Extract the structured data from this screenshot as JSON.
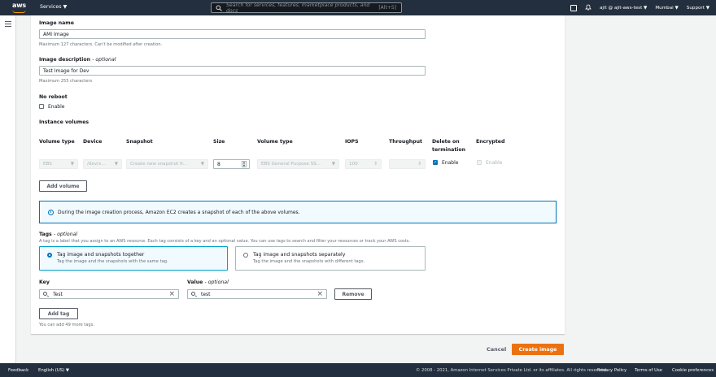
{
  "topbar": {
    "logo": "aws",
    "services": "Services ▼",
    "search_placeholder": "Search for services, features, marketplace products, and docs",
    "search_shortcut": "[Alt+S]",
    "account": "ajit @ ajit-aws-test ▼",
    "region": "Mumbai ▼",
    "support": "Support ▼"
  },
  "form": {
    "image_name_label": "Image name",
    "image_name_value": "AMI Image",
    "image_name_hint": "Maximum 127 characters. Can't be modified after creation.",
    "desc_label": "Image description",
    "desc_optional": "- optional",
    "desc_value": "Test Image for Dev",
    "desc_hint": "Maximum 255 characters",
    "noreboot_label": "No reboot",
    "noreboot_enable": "Enable",
    "volumes_label": "Instance volumes",
    "columns": {
      "volume_type": "Volume type",
      "device": "Device",
      "snapshot": "Snapshot",
      "size": "Size",
      "vol_type": "Volume type",
      "iops": "IOPS",
      "throughput": "Throughput",
      "delete_on": "Delete on",
      "termination": "termination",
      "encrypted": "Encrypted"
    },
    "row": {
      "volume_type": "EBS",
      "device": "/dev/x...",
      "snapshot": "Create new snapshot fr...",
      "size": "8",
      "vol_type": "EBS General Purpose SS...",
      "iops": "100",
      "delete_enable": "Enable",
      "encrypted_enable": "Enable"
    },
    "add_volume": "Add volume",
    "info_text": "During the image creation process, Amazon EC2 creates a snapshot of each of the above volumes.",
    "tags_label": "Tags",
    "tags_optional": "- optional",
    "tags_hint": "A tag is a label that you assign to an AWS resource. Each tag consists of a key and an optional value. You can use tags to search and filter your resources or track your AWS costs.",
    "tag_together_title": "Tag image and snapshots together",
    "tag_together_desc": "Tag the image and the snapshots with the same tag.",
    "tag_separate_title": "Tag image and snapshots separately",
    "tag_separate_desc": "Tag the image and the snapshots with different tags.",
    "key_label": "Key",
    "value_label": "Value",
    "value_optional": "- optional",
    "key_value": "Test",
    "value_value": "test",
    "remove": "Remove",
    "add_tag": "Add tag",
    "tags_left": "You can add 49 more tags."
  },
  "actions": {
    "cancel": "Cancel",
    "create": "Create image"
  },
  "footer": {
    "feedback": "Feedback",
    "language": "English (US) ▼",
    "copyright": "© 2008 - 2021, Amazon Internet Services Private Ltd. or its affiliates. All rights reserved.",
    "privacy": "Privacy Policy",
    "terms": "Terms of Use",
    "cookies": "Cookie preferences"
  },
  "colors": {
    "primary": "#ec7211",
    "topbar": "#232f3e",
    "link": "#0073bb"
  }
}
